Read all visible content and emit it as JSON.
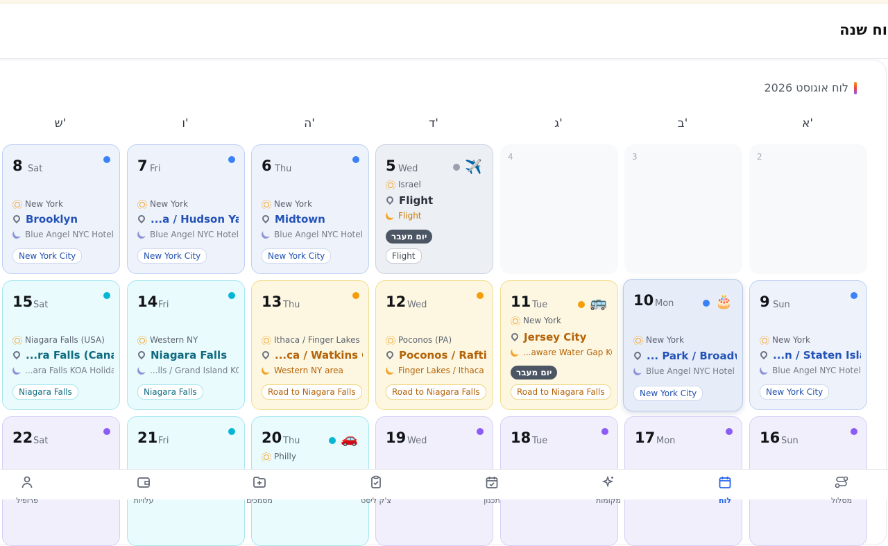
{
  "header": {
    "title": "וח שנה"
  },
  "calendar": {
    "month_label": "לוח אוגוסט 2026",
    "weekdays": [
      "ש'",
      "ו'",
      "ה'",
      "ד'",
      "ג'",
      "ב'",
      "א'"
    ],
    "empty_days": [
      "4",
      "3",
      "2"
    ],
    "days": {
      "d8": {
        "num": "8",
        "name": "Sat",
        "region": "New York",
        "place": "Brooklyn",
        "hotel": "Blue Angel NYC Hotel",
        "chip": "New York City"
      },
      "d7": {
        "num": "7",
        "name": "Fri",
        "region": "New York",
        "place": "...a / Hudson Yards",
        "hotel": "Blue Angel NYC Hotel",
        "chip": "New York City"
      },
      "d6": {
        "num": "6",
        "name": "Thu",
        "region": "New York",
        "place": "Midtown",
        "hotel": "Blue Angel NYC Hotel",
        "chip": "New York City"
      },
      "d5": {
        "num": "5",
        "name": "Wed",
        "region": "Israel",
        "place": "Flight",
        "hotel": "Flight",
        "transit": "יום מעבר",
        "chip": "Flight",
        "emoji": "✈️"
      },
      "d15": {
        "num": "15",
        "name": "Sat",
        "region": "Niagara Falls (USA)",
        "place": "...ra Falls (Canada)",
        "hotel": "...ara Falls KOA Holiday",
        "chip": "Niagara Falls"
      },
      "d14": {
        "num": "14",
        "name": "Fri",
        "region": "Western NY",
        "place": "Niagara Falls",
        "hotel": "...lls / Grand Island KOA",
        "chip": "Niagara Falls"
      },
      "d13": {
        "num": "13",
        "name": "Thu",
        "region": "Ithaca / Finger Lakes",
        "place": "...ca / Watkins Glen",
        "hotel": "Western NY area",
        "chip": "Road to Niagara Falls"
      },
      "d12": {
        "num": "12",
        "name": "Wed",
        "region": "Poconos (PA)",
        "place": "Poconos / Rafting",
        "hotel": "Finger Lakes / Ithaca",
        "chip": "Road to Niagara Falls"
      },
      "d11": {
        "num": "11",
        "name": "Tue",
        "region": "New York",
        "place": "Jersey City",
        "hotel": "...aware Water Gap KOA",
        "transit": "יום מעבר",
        "chip": "Road to Niagara Falls",
        "emoji": "🚌"
      },
      "d10": {
        "num": "10",
        "name": "Mon",
        "region": "New York",
        "place": "... Park / Broadway",
        "hotel": "Blue Angel NYC Hotel",
        "chip": "New York City",
        "emoji": "🎂"
      },
      "d9": {
        "num": "9",
        "name": "Sun",
        "region": "New York",
        "place": "...n / Staten Island",
        "hotel": "Blue Angel NYC Hotel",
        "chip": "New York City"
      },
      "d22": {
        "num": "22",
        "name": "Sat"
      },
      "d21": {
        "num": "21",
        "name": "Fri"
      },
      "d20": {
        "num": "20",
        "name": "Thu",
        "region": "Philly",
        "emoji": "🚗"
      },
      "d19": {
        "num": "19",
        "name": "Wed"
      },
      "d18": {
        "num": "18",
        "name": "Tue"
      },
      "d17": {
        "num": "17",
        "name": "Mon"
      },
      "d16": {
        "num": "16",
        "name": "Sun"
      }
    }
  },
  "nav": {
    "items": [
      {
        "label": "פרופיל",
        "icon": "user-icon"
      },
      {
        "label": "עלויות",
        "icon": "wallet-icon"
      },
      {
        "label": "מסמכים",
        "icon": "folder-plus-icon"
      },
      {
        "label": "צ'ק ליסט",
        "icon": "clipboard-check-icon"
      },
      {
        "label": "תכנון",
        "icon": "calendar-check-icon"
      },
      {
        "label": "מקומות",
        "icon": "sparkles-icon"
      },
      {
        "label": "לוח",
        "icon": "calendar-icon"
      },
      {
        "label": "מסלול",
        "icon": "route-icon"
      }
    ]
  },
  "colors": {
    "accent": "#2563eb",
    "blue_dot": "#3b82f6",
    "cyan_dot": "#06b6d4",
    "orange_dot": "#f59e0b",
    "purple_dot": "#8b5cf6"
  }
}
